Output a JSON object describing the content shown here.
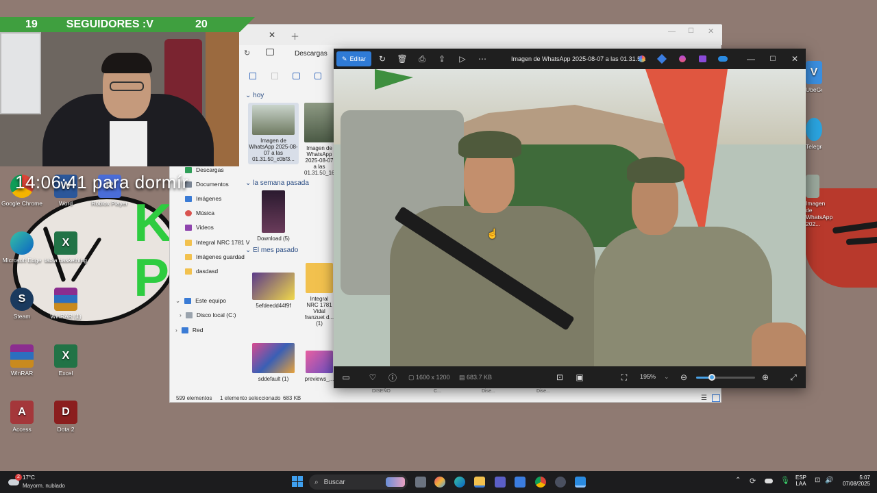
{
  "overlay": {
    "follow_left": "19",
    "follow_label": "SEGUIDORES :V",
    "follow_right": "20",
    "timer_text": "14:06:41 para dormír"
  },
  "desktop": {
    "icons": [
      {
        "label": "Google Chrome"
      },
      {
        "label": "Word"
      },
      {
        "label": "Roblox Player"
      },
      {
        "label": "Microsoft Edge"
      },
      {
        "label": "tabla baskething"
      },
      {
        "label": "Steam"
      },
      {
        "label": "WinRAR (1)"
      },
      {
        "label": "WinRAR"
      },
      {
        "label": "Excel"
      },
      {
        "label": "Access"
      },
      {
        "label": "Dota 2"
      },
      {
        "label": "UbeGo"
      },
      {
        "label": "Telegram"
      },
      {
        "label": "Imagen de WhatsApp 202..."
      }
    ],
    "wall_letters": "KE\nPI"
  },
  "explorer": {
    "location": "Descargas",
    "nav": [
      {
        "label": "Descargas"
      },
      {
        "label": "Documentos"
      },
      {
        "label": "Imágenes"
      },
      {
        "label": "Música"
      },
      {
        "label": "Videos"
      },
      {
        "label": "Integral NRC 1781 V"
      },
      {
        "label": "Imágenes guardad"
      },
      {
        "label": "dasdasd"
      },
      {
        "label": "Este equipo"
      },
      {
        "label": "Disco local (C:)"
      },
      {
        "label": "Red"
      }
    ],
    "groups": {
      "today": "hoy",
      "last_week": "la semana pasada",
      "last_month": "El mes pasado"
    },
    "files": [
      {
        "name": "Imagen de WhatsApp 2025-08-07 a las 01.31.50_c0bf3..."
      },
      {
        "name": "Imagen de WhatsApp 2025-08-07 a las 01.31.50_16..."
      },
      {
        "name": "Download (5)"
      },
      {
        "name": "5efdeedd44f9f"
      },
      {
        "name": "Integral NRC 1781 Vidal franzuet d... (1)"
      },
      {
        "name": "sddefault (1)"
      },
      {
        "name": "previews_..."
      }
    ],
    "status_count": "599 elementos",
    "status_selected": "1 elemento seleccionado",
    "status_size": "683 KB",
    "peek_labels": [
      "DISEÑO",
      "C...",
      "Dise...",
      "Dise..."
    ]
  },
  "viewer": {
    "edit_label": "Editar",
    "title": "Imagen de WhatsApp 2025-08-07 a las 01.31.5...",
    "dimensions": "1600 x 1200",
    "filesize": "683.7 KB",
    "zoom": "195%",
    "zoom_fraction": 0.27
  },
  "taskbar": {
    "temperature": "17°C",
    "weather": "Mayorm. nublado",
    "weather_badge": "2",
    "search_placeholder": "Buscar",
    "lang_top": "ESP",
    "lang_bottom": "LAA",
    "time": "5:07",
    "date": "07/08/2025"
  },
  "colors": {
    "accent": "#0067c0",
    "overlay_green": "#3f9f3f",
    "wallpaper": "#8f7a72",
    "taskbar": "#1c1c1e"
  }
}
